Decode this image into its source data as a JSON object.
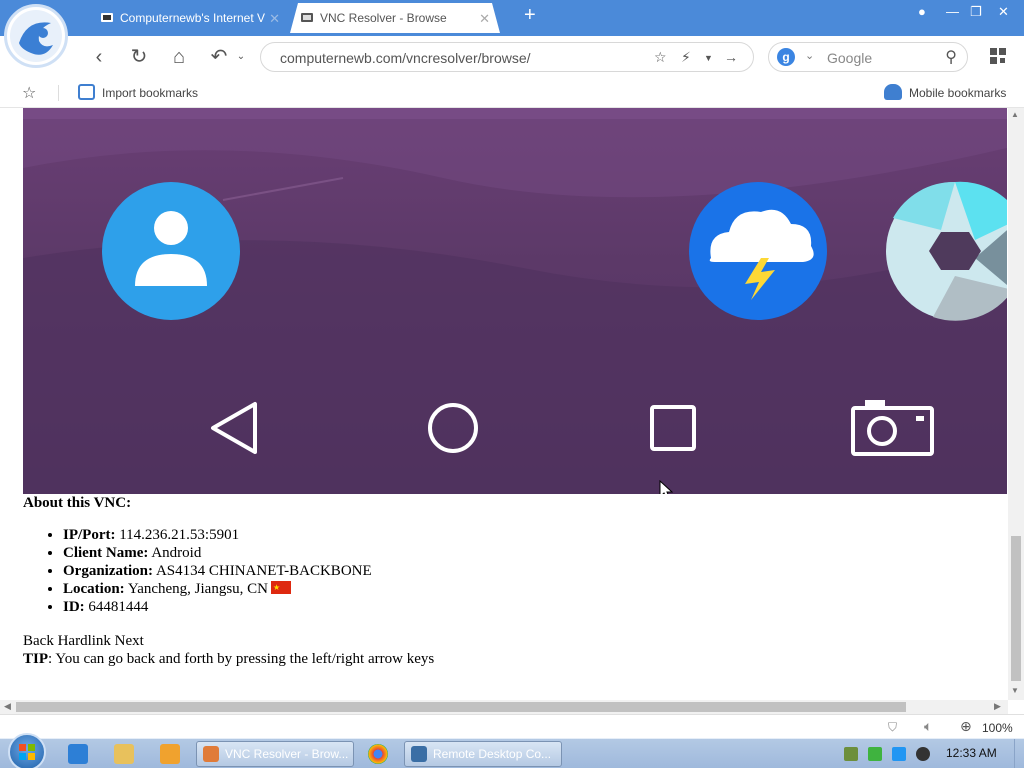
{
  "browser": {
    "tabs": [
      {
        "label": "Computernewb's Internet V",
        "active": false
      },
      {
        "label": "VNC Resolver - Browse",
        "active": true
      }
    ],
    "address": "computernewb.com/vncresolver/browse/",
    "search_placeholder": "Google",
    "search_engine_letter": "g",
    "bookmarks": {
      "import_label": "Import bookmarks",
      "mobile_label": "Mobile bookmarks"
    },
    "zoom": "100%"
  },
  "page": {
    "about_heading": "About this VNC:",
    "details": [
      {
        "label": "IP/Port:",
        "value": "114.236.21.53:5901"
      },
      {
        "label": "Client Name:",
        "value": "Android"
      },
      {
        "label": "Organization:",
        "value": "AS4134 CHINANET-BACKBONE"
      },
      {
        "label": "Location:",
        "value": "Yancheng, Jiangsu, CN"
      },
      {
        "label": "ID:",
        "value": "64481444"
      }
    ],
    "pager": {
      "back": "Back",
      "hardlink": "Hardlink",
      "next": "Next"
    },
    "tip_label": "TIP",
    "tip_text": ": You can go back and forth by pressing the left/right arrow keys"
  },
  "taskbar": {
    "tasks": [
      {
        "label": "VNC Resolver - Brow...",
        "active": true
      },
      {
        "label": "Remote Desktop Co...",
        "active": false
      }
    ],
    "clock": "12:33 AM"
  },
  "colors": {
    "titlebar": "#4b8ad9",
    "vnc_background": "#5c3968",
    "contacts_icon": "#2ea0ea",
    "weather_icon": "#1a73e8",
    "bolt": "#fdd835",
    "camera_teal": "#5ce1f0"
  }
}
